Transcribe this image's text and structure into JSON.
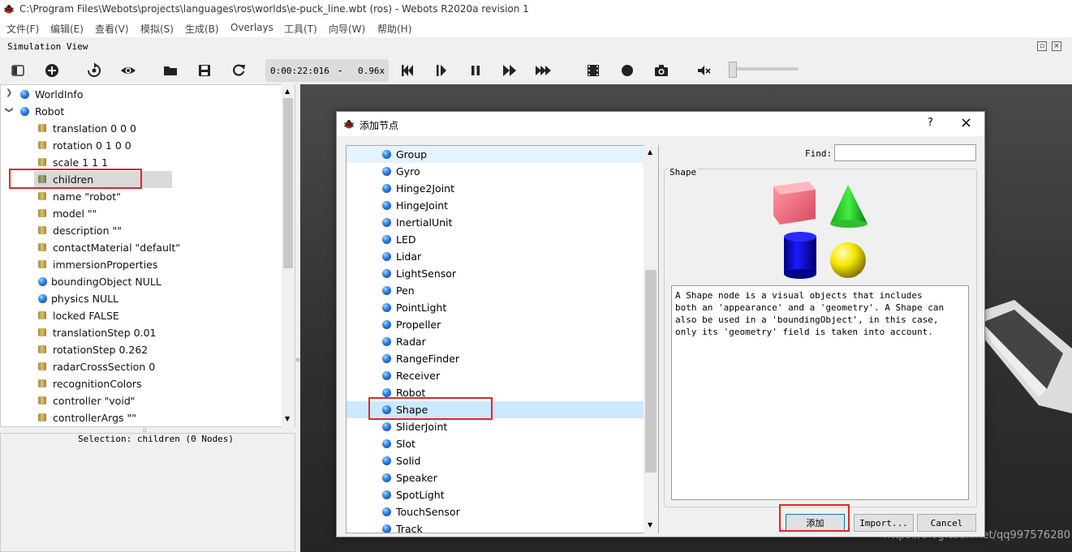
{
  "window": {
    "title": "C:\\Program Files\\Webots\\projects\\languages\\ros\\worlds\\e-puck_line.wbt (ros) - Webots R2020a revision 1"
  },
  "menu": [
    "文件(F)",
    "编辑(E)",
    "查看(V)",
    "模拟(S)",
    "生成(B)",
    "Overlays",
    "工具(T)",
    "向导(W)",
    "帮助(H)"
  ],
  "simview": {
    "title": "Simulation View"
  },
  "time": {
    "clock": "0:00:22:016",
    "separator": "-",
    "speed": "0.96x"
  },
  "tree": [
    {
      "label": "WorldInfo",
      "type": "node",
      "arrow": ">"
    },
    {
      "label": "Robot",
      "type": "node",
      "arrow": "v"
    },
    {
      "label": "translation 0 0 0",
      "type": "field"
    },
    {
      "label": "rotation 0 1 0 0",
      "type": "field"
    },
    {
      "label": "scale 1 1 1",
      "type": "field"
    },
    {
      "label": "children",
      "type": "field",
      "selected": true
    },
    {
      "label": "name \"robot\"",
      "type": "field"
    },
    {
      "label": "model \"\"",
      "type": "field"
    },
    {
      "label": "description \"\"",
      "type": "field"
    },
    {
      "label": "contactMaterial \"default\"",
      "type": "field"
    },
    {
      "label": "immersionProperties",
      "type": "field"
    },
    {
      "label": "boundingObject NULL",
      "type": "node"
    },
    {
      "label": "physics NULL",
      "type": "node"
    },
    {
      "label": "locked FALSE",
      "type": "field"
    },
    {
      "label": "translationStep 0.01",
      "type": "field"
    },
    {
      "label": "rotationStep 0.262",
      "type": "field"
    },
    {
      "label": "radarCrossSection 0",
      "type": "field"
    },
    {
      "label": "recognitionColors",
      "type": "field"
    },
    {
      "label": "controller \"void\"",
      "type": "field"
    },
    {
      "label": "controllerArgs \"\"",
      "type": "field"
    }
  ],
  "selection": {
    "text": "Selection: children (0 Nodes)"
  },
  "dialog": {
    "title": "添加节点",
    "help": "?",
    "find_label": "Find:",
    "find_value": "",
    "preview_title": "Shape",
    "description": "A Shape node is a visual objects that includes\nboth an 'appearance' and a 'geometry'. A Shape can\nalso be used in a 'boundingObject', in this case,\nonly its 'geometry' field is taken into account.",
    "add_label": "添加",
    "import_label": "Import...",
    "cancel_label": "Cancel",
    "nodes": [
      "Group",
      "Gyro",
      "Hinge2Joint",
      "HingeJoint",
      "InertialUnit",
      "LED",
      "Lidar",
      "LightSensor",
      "Pen",
      "PointLight",
      "Propeller",
      "Radar",
      "RangeFinder",
      "Receiver",
      "Robot",
      "Shape",
      "SliderJoint",
      "Slot",
      "Solid",
      "Speaker",
      "SpotLight",
      "TouchSensor",
      "Track"
    ],
    "selected_node": "Shape"
  },
  "watermark": "https://blog.csdn.net/qq997576280",
  "colors": {
    "highlight_red": "#e0262b",
    "selection_blue": "#cce8ff",
    "scene_bg": "#3a3a3a"
  }
}
